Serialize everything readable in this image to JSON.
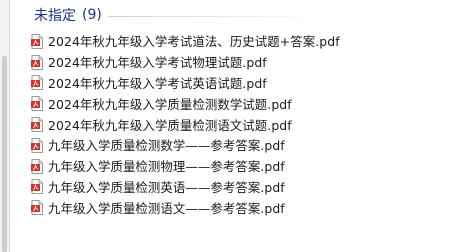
{
  "group": {
    "title": "未指定",
    "count": "(9)"
  },
  "files": [
    {
      "name": "2024年秋九年级入学考试道法、历史试题+答案.pdf",
      "icon": "pdf-icon"
    },
    {
      "name": "2024年秋九年级入学考试物理试题.pdf",
      "icon": "pdf-icon"
    },
    {
      "name": "2024年秋九年级入学考试英语试题.pdf",
      "icon": "pdf-icon"
    },
    {
      "name": "2024年秋九年级入学质量检测数学试题.pdf",
      "icon": "pdf-icon"
    },
    {
      "name": "2024年秋九年级入学质量检测语文试题.pdf",
      "icon": "pdf-icon"
    },
    {
      "name": "九年级入学质量检测数学——参考答案.pdf",
      "icon": "pdf-icon"
    },
    {
      "name": "九年级入学质量检测物理——参考答案.pdf",
      "icon": "pdf-icon"
    },
    {
      "name": "九年级入学质量检测英语——参考答案.pdf",
      "icon": "pdf-icon"
    },
    {
      "name": "九年级入学质量检测语文——参考答案.pdf",
      "icon": "pdf-icon"
    }
  ],
  "colors": {
    "group_header": "#1e3287",
    "pdf_icon": "#d0342c"
  }
}
